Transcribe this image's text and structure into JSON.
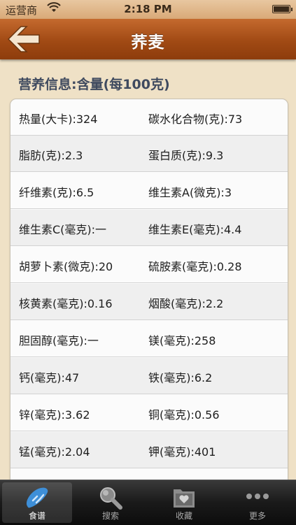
{
  "status_bar": {
    "carrier": "运营商",
    "time": "2:18 PM"
  },
  "nav": {
    "title": "荞麦"
  },
  "section": {
    "title": "营养信息:含量(每100克)"
  },
  "nutrients": [
    {
      "left": "热量(大卡):324",
      "right": "碳水化合物(克):73"
    },
    {
      "left": "脂肪(克):2.3",
      "right": "蛋白质(克):9.3"
    },
    {
      "left": "纤维素(克):6.5",
      "right": "维生素A(微克):3"
    },
    {
      "left": "维生素C(毫克):一",
      "right": "维生素E(毫克):4.4"
    },
    {
      "left": "胡萝卜素(微克):20",
      "right": "硫胺素(毫克):0.28"
    },
    {
      "left": "核黄素(毫克):0.16",
      "right": "烟酸(毫克):2.2"
    },
    {
      "left": "胆固醇(毫克):一",
      "right": "镁(毫克):258"
    },
    {
      "left": "钙(毫克):47",
      "right": "铁(毫克):6.2"
    },
    {
      "left": "锌(毫克):3.62",
      "right": "铜(毫克):0.56"
    },
    {
      "left": "锰(毫克):2.04",
      "right": "钾(毫克):401"
    }
  ],
  "tabs": [
    {
      "label": "食谱",
      "icon": "bread-icon",
      "active": true
    },
    {
      "label": "搜索",
      "icon": "search-icon",
      "active": false
    },
    {
      "label": "收藏",
      "icon": "favorites-folder-icon",
      "active": false
    },
    {
      "label": "更多",
      "icon": "more-dots-icon",
      "active": false
    }
  ],
  "colors": {
    "nav": "#a14a14",
    "background": "#efe1c6",
    "section_title": "#3f4a5f"
  }
}
